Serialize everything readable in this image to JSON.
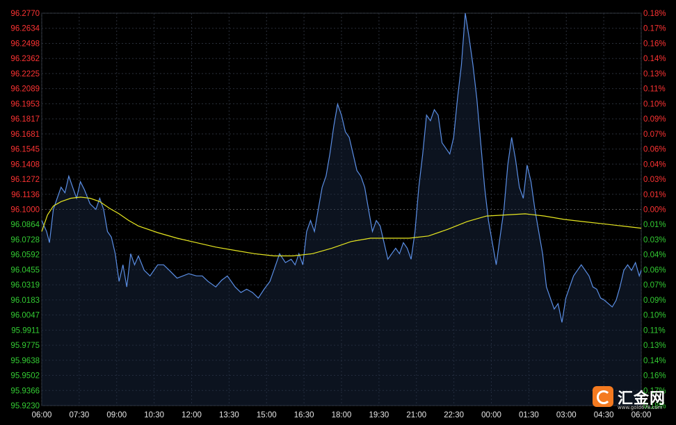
{
  "chart_data": {
    "type": "line",
    "y_ticks_left": [
      "96.2770",
      "96.2634",
      "96.2498",
      "96.2362",
      "96.2225",
      "96.2089",
      "96.1953",
      "96.1817",
      "96.1681",
      "96.1545",
      "96.1408",
      "96.1272",
      "96.1136",
      "96.1000",
      "96.0864",
      "96.0728",
      "96.0592",
      "96.0455",
      "96.0319",
      "96.0183",
      "96.0047",
      "95.9911",
      "95.9775",
      "95.9638",
      "95.9502",
      "95.9366",
      "95.9230"
    ],
    "y_ticks_right": [
      "0.18%",
      "0.17%",
      "0.16%",
      "0.14%",
      "0.13%",
      "0.11%",
      "0.10%",
      "0.09%",
      "0.07%",
      "0.06%",
      "0.04%",
      "0.03%",
      "0.01%",
      "0.00%",
      "0.01%",
      "0.03%",
      "0.04%",
      "0.06%",
      "0.07%",
      "0.09%",
      "0.10%",
      "0.11%",
      "0.13%",
      "0.14%",
      "0.16%",
      "0.17%",
      "0.18%"
    ],
    "x_ticks": [
      "06:00",
      "07:30",
      "09:00",
      "10:30",
      "12:00",
      "13:30",
      "15:00",
      "16:30",
      "18:00",
      "19:30",
      "21:00",
      "22:30",
      "00:00",
      "01:30",
      "03:00",
      "04:30",
      "06:00"
    ],
    "ylim": [
      95.923,
      96.277
    ],
    "reference": 96.1,
    "colors": {
      "up": "#ff3333",
      "down": "#33cc33",
      "price": "#5b8fe6",
      "avg": "#e8e820",
      "grid": "#2a2f3a",
      "axis_text": "#e6e6e6"
    },
    "series": [
      {
        "values": [
          [
            0,
            96.09
          ],
          [
            0.25,
            96.08
          ],
          [
            0.4,
            96.07
          ],
          [
            0.6,
            96.1
          ],
          [
            0.8,
            96.11
          ],
          [
            1.0,
            96.12
          ],
          [
            1.2,
            96.115
          ],
          [
            1.4,
            96.13
          ],
          [
            1.6,
            96.12
          ],
          [
            1.8,
            96.11
          ],
          [
            2.0,
            96.125
          ],
          [
            2.2,
            96.118
          ],
          [
            2.5,
            96.105
          ],
          [
            2.8,
            96.1
          ],
          [
            3.0,
            96.11
          ],
          [
            3.2,
            96.1
          ],
          [
            3.4,
            96.08
          ],
          [
            3.6,
            96.075
          ],
          [
            3.8,
            96.06
          ],
          [
            4.0,
            96.035
          ],
          [
            4.2,
            96.05
          ],
          [
            4.4,
            96.03
          ],
          [
            4.6,
            96.06
          ],
          [
            4.8,
            96.05
          ],
          [
            5.0,
            96.058
          ],
          [
            5.3,
            96.045
          ],
          [
            5.6,
            96.04
          ],
          [
            6.0,
            96.05
          ],
          [
            6.3,
            96.05
          ],
          [
            6.6,
            96.045
          ],
          [
            7.0,
            96.038
          ],
          [
            7.3,
            96.04
          ],
          [
            7.6,
            96.042
          ],
          [
            8.0,
            96.04
          ],
          [
            8.3,
            96.04
          ],
          [
            8.6,
            96.035
          ],
          [
            9.0,
            96.03
          ],
          [
            9.3,
            96.036
          ],
          [
            9.6,
            96.04
          ],
          [
            10.0,
            96.03
          ],
          [
            10.3,
            96.025
          ],
          [
            10.6,
            96.028
          ],
          [
            10.9,
            96.025
          ],
          [
            11.2,
            96.02
          ],
          [
            11.5,
            96.028
          ],
          [
            11.8,
            96.035
          ],
          [
            12.0,
            96.045
          ],
          [
            12.3,
            96.06
          ],
          [
            12.6,
            96.052
          ],
          [
            12.9,
            96.055
          ],
          [
            13.1,
            96.05
          ],
          [
            13.3,
            96.06
          ],
          [
            13.5,
            96.05
          ],
          [
            13.7,
            96.08
          ],
          [
            13.9,
            96.09
          ],
          [
            14.1,
            96.08
          ],
          [
            14.3,
            96.1
          ],
          [
            14.5,
            96.12
          ],
          [
            14.7,
            96.13
          ],
          [
            14.9,
            96.15
          ],
          [
            15.1,
            96.175
          ],
          [
            15.3,
            96.195
          ],
          [
            15.5,
            96.185
          ],
          [
            15.7,
            96.17
          ],
          [
            15.9,
            96.165
          ],
          [
            16.1,
            96.15
          ],
          [
            16.3,
            96.135
          ],
          [
            16.5,
            96.13
          ],
          [
            16.7,
            96.12
          ],
          [
            16.9,
            96.1
          ],
          [
            17.1,
            96.08
          ],
          [
            17.3,
            96.09
          ],
          [
            17.5,
            96.085
          ],
          [
            17.7,
            96.07
          ],
          [
            17.9,
            96.055
          ],
          [
            18.1,
            96.06
          ],
          [
            18.3,
            96.065
          ],
          [
            18.5,
            96.06
          ],
          [
            18.7,
            96.07
          ],
          [
            18.9,
            96.065
          ],
          [
            19.1,
            96.055
          ],
          [
            19.3,
            96.08
          ],
          [
            19.5,
            96.12
          ],
          [
            19.7,
            96.15
          ],
          [
            19.9,
            96.185
          ],
          [
            20.1,
            96.18
          ],
          [
            20.3,
            96.19
          ],
          [
            20.5,
            96.185
          ],
          [
            20.7,
            96.16
          ],
          [
            20.9,
            96.155
          ],
          [
            21.1,
            96.15
          ],
          [
            21.3,
            96.165
          ],
          [
            21.5,
            96.2
          ],
          [
            21.7,
            96.23
          ],
          [
            21.9,
            96.277
          ],
          [
            22.1,
            96.255
          ],
          [
            22.3,
            96.23
          ],
          [
            22.5,
            96.2
          ],
          [
            22.7,
            96.16
          ],
          [
            22.9,
            96.12
          ],
          [
            23.1,
            96.09
          ],
          [
            23.3,
            96.07
          ],
          [
            23.5,
            96.05
          ],
          [
            23.7,
            96.075
          ],
          [
            23.9,
            96.1
          ],
          [
            24.1,
            96.14
          ],
          [
            24.3,
            96.165
          ],
          [
            24.5,
            96.145
          ],
          [
            24.7,
            96.12
          ],
          [
            24.9,
            96.11
          ],
          [
            25.1,
            96.14
          ],
          [
            25.3,
            96.125
          ],
          [
            25.5,
            96.1
          ],
          [
            25.7,
            96.08
          ],
          [
            25.9,
            96.06
          ],
          [
            26.1,
            96.03
          ],
          [
            26.3,
            96.02
          ],
          [
            26.5,
            96.01
          ],
          [
            26.7,
            96.015
          ],
          [
            26.9,
            95.998
          ],
          [
            27.1,
            96.02
          ],
          [
            27.3,
            96.03
          ],
          [
            27.5,
            96.04
          ],
          [
            27.7,
            96.045
          ],
          [
            27.9,
            96.05
          ],
          [
            28.1,
            96.045
          ],
          [
            28.3,
            96.04
          ],
          [
            28.5,
            96.03
          ],
          [
            28.7,
            96.028
          ],
          [
            28.9,
            96.02
          ],
          [
            29.1,
            96.018
          ],
          [
            29.3,
            96.015
          ],
          [
            29.5,
            96.012
          ],
          [
            29.7,
            96.018
          ],
          [
            29.9,
            96.03
          ],
          [
            30.1,
            96.045
          ],
          [
            30.3,
            96.05
          ],
          [
            30.5,
            96.045
          ],
          [
            30.7,
            96.052
          ],
          [
            30.9,
            96.04
          ],
          [
            31.0,
            96.045
          ]
        ]
      },
      {
        "values": [
          [
            0,
            96.08
          ],
          [
            0.3,
            96.095
          ],
          [
            0.6,
            96.103
          ],
          [
            1.0,
            96.107
          ],
          [
            1.5,
            96.11
          ],
          [
            2.0,
            96.111
          ],
          [
            2.5,
            96.11
          ],
          [
            3.0,
            96.107
          ],
          [
            3.5,
            96.101
          ],
          [
            4.0,
            96.096
          ],
          [
            4.5,
            96.09
          ],
          [
            5.0,
            96.085
          ],
          [
            6.0,
            96.079
          ],
          [
            7.0,
            96.074
          ],
          [
            8.0,
            96.07
          ],
          [
            9.0,
            96.066
          ],
          [
            10.0,
            96.063
          ],
          [
            11.0,
            96.06
          ],
          [
            12.0,
            96.058
          ],
          [
            13.0,
            96.058
          ],
          [
            14.0,
            96.06
          ],
          [
            15.0,
            96.065
          ],
          [
            16.0,
            96.071
          ],
          [
            17.0,
            96.074
          ],
          [
            18.0,
            96.074
          ],
          [
            19.0,
            96.074
          ],
          [
            20.0,
            96.076
          ],
          [
            21.0,
            96.082
          ],
          [
            22.0,
            96.089
          ],
          [
            23.0,
            96.094
          ],
          [
            24.0,
            96.095
          ],
          [
            25.0,
            96.096
          ],
          [
            26.0,
            96.094
          ],
          [
            27.0,
            96.091
          ],
          [
            28.0,
            96.089
          ],
          [
            29.0,
            96.087
          ],
          [
            30.0,
            96.085
          ],
          [
            31.0,
            96.083
          ]
        ]
      }
    ]
  },
  "brand": {
    "name": "汇金网",
    "url": "www.gold678.com"
  }
}
